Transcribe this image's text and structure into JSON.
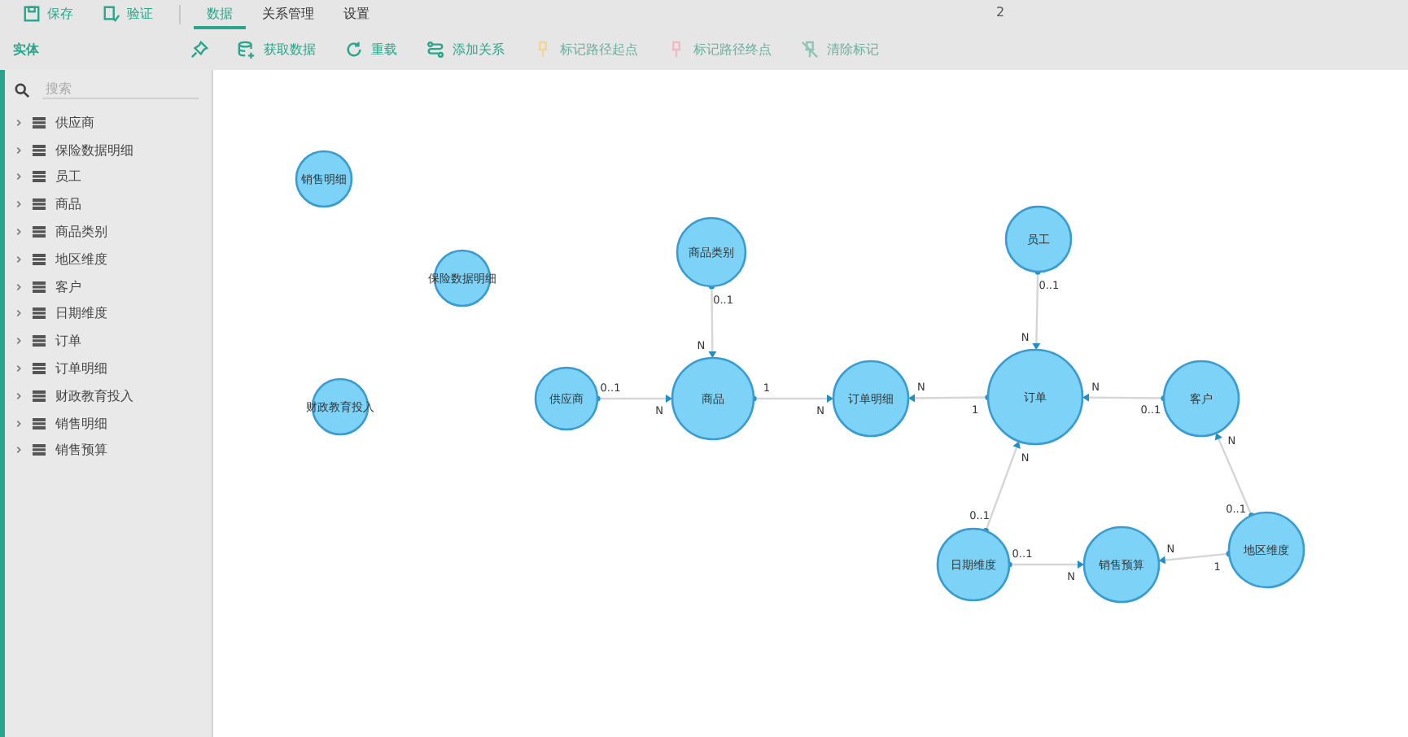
{
  "window": {
    "title": "2"
  },
  "menu": [
    {
      "kind": "action",
      "label": "保存",
      "selected": false
    },
    {
      "kind": "action",
      "label": "验证",
      "selected": false
    },
    {
      "kind": "tab",
      "label": "数据",
      "selected": true
    },
    {
      "kind": "tab",
      "label": "关系管理",
      "selected": false
    },
    {
      "kind": "tab",
      "label": "设置",
      "selected": false
    }
  ],
  "toolbar": {
    "section": "实体",
    "buttons": [
      {
        "disabled": false
      },
      {
        "label": "获取数据",
        "disabled": false
      },
      {
        "label": "重载",
        "disabled": false
      },
      {
        "label": "添加关系",
        "disabled": false
      },
      {
        "label": "标记路径起点",
        "disabled": true
      },
      {
        "label": "标记路径终点",
        "disabled": true
      },
      {
        "label": "清除标记",
        "disabled": true
      }
    ]
  },
  "sidebar": {
    "search": {
      "placeholder": "搜索"
    },
    "items": [
      {
        "label": "供应商",
        "expanded": false
      },
      {
        "label": "保险数据明细",
        "expanded": false
      },
      {
        "label": "员工",
        "expanded": false
      },
      {
        "label": "商品",
        "expanded": false
      },
      {
        "label": "商品类别",
        "expanded": false
      },
      {
        "label": "地区维度",
        "expanded": false
      },
      {
        "label": "客户",
        "expanded": false
      },
      {
        "label": "日期维度",
        "expanded": false
      },
      {
        "label": "订单",
        "expanded": false
      },
      {
        "label": "订单明细",
        "expanded": false
      },
      {
        "label": "财政教育投入",
        "expanded": false
      },
      {
        "label": "销售明细",
        "expanded": false
      },
      {
        "label": "销售预算",
        "expanded": false
      }
    ]
  },
  "diagram": {
    "nodes": [
      {
        "label": "销售明细"
      },
      {
        "label": "保险数据明细"
      },
      {
        "label": "财政教育投入"
      },
      {
        "label": "供应商"
      },
      {
        "label": "商品"
      },
      {
        "label": "商品类别"
      },
      {
        "label": "订单明细"
      },
      {
        "label": "订单"
      },
      {
        "label": "员工"
      },
      {
        "label": "客户"
      },
      {
        "label": "日期维度"
      },
      {
        "label": "销售预算"
      },
      {
        "label": "地区维度"
      }
    ],
    "edges": [
      {
        "from_label": "0..1",
        "to_label": "N"
      },
      {
        "from_label": "0..1",
        "to_label": "N"
      },
      {
        "from_label": "1",
        "to_label": "N"
      },
      {
        "from_label": "1",
        "to_label": "N"
      },
      {
        "from_label": "0..1",
        "to_label": "N"
      },
      {
        "from_label": "0..1",
        "to_label": "N"
      },
      {
        "from_label": "0..1",
        "to_label": "N"
      },
      {
        "from_label": "0..1",
        "to_label": "N"
      },
      {
        "from_label": "0..1",
        "to_label": "N"
      },
      {
        "from_label": "1",
        "to_label": "N"
      }
    ]
  }
}
